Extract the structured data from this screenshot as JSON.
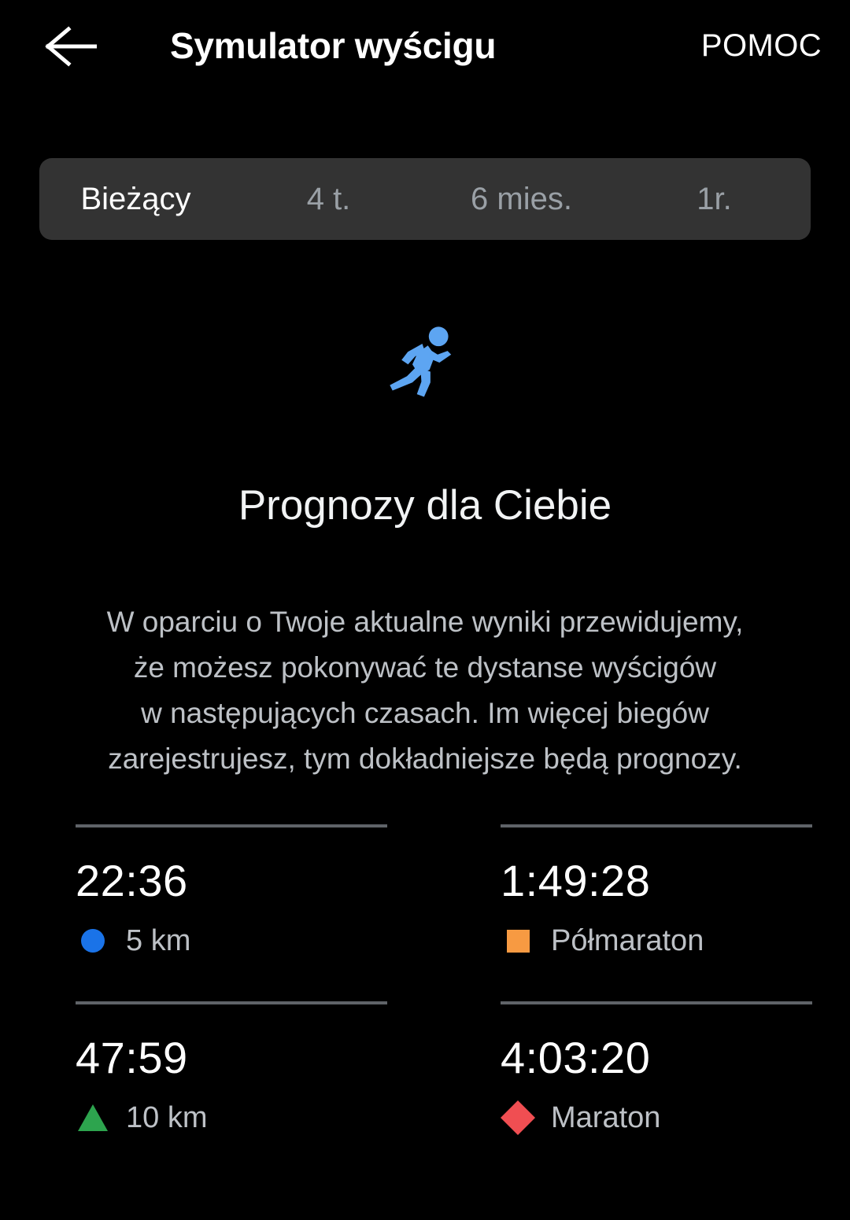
{
  "header": {
    "back_icon": "arrow-left-icon",
    "title": "Symulator wyścigu",
    "help_label": "POMOC"
  },
  "tabs": {
    "items": [
      {
        "label": "Bieżący",
        "active": true
      },
      {
        "label": "4 t.",
        "active": false
      },
      {
        "label": "6 mies.",
        "active": false
      },
      {
        "label": "1r.",
        "active": false
      }
    ]
  },
  "hero": {
    "icon": "running-person-icon",
    "icon_color": "#5DA5F2",
    "title": "Prognozy dla Ciebie",
    "description_lines": [
      "W oparciu o Twoje aktualne wyniki przewidujemy,",
      "że możesz pokonywać te dystanse wyścigów",
      "w następujących czasach. Im więcej biegów",
      "zarejestrujesz, tym dokładniejsze będą prognozy."
    ]
  },
  "predictions": [
    {
      "time": "22:36",
      "label": "5 km",
      "marker": "circle-marker-icon",
      "color": "#1A73E8"
    },
    {
      "time": "1:49:28",
      "label": "Półmaraton",
      "marker": "square-marker-icon",
      "color": "#F79A42"
    },
    {
      "time": "47:59",
      "label": "10 km",
      "marker": "triangle-marker-icon",
      "color": "#2DA44E"
    },
    {
      "time": "4:03:20",
      "label": "Maraton",
      "marker": "diamond-marker-icon",
      "color": "#F04E52"
    }
  ],
  "colors": {
    "background": "#000000",
    "tabbar_background": "#333333",
    "text_primary": "#FFFFFF",
    "text_secondary": "#BDC1C6",
    "text_muted": "#9AA0A6",
    "divider": "#5F6368",
    "accent_blue": "#5DA5F2"
  }
}
